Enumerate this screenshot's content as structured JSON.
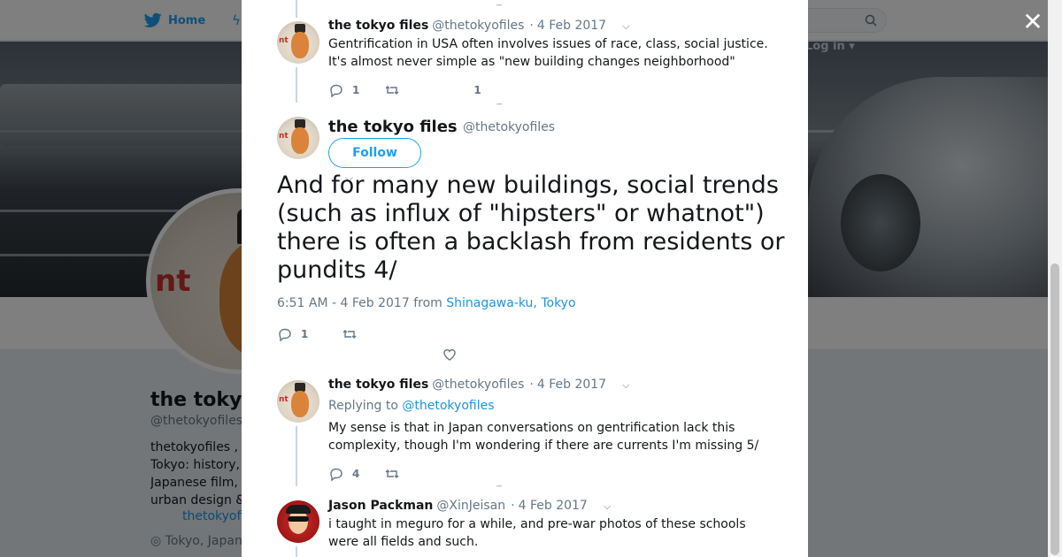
{
  "nav": {
    "home_label": "Home",
    "search_placeholder": "",
    "login_label": "Log in ▾"
  },
  "profile": {
    "name": "the tokyo files",
    "handle": "@thetokyofiles",
    "bio_lines": [
      "thetokyofiles ,",
      "Tokyo: history,",
      "Japanese film,",
      "urban design &"
    ],
    "url": "thetokyofiles",
    "location": "◎ Tokyo, Japan"
  },
  "modal": {
    "close_label": "✕",
    "tweets": [
      {
        "name": "the tokyo files",
        "handle": "@thetokyofiles",
        "date": "4 Feb 2017",
        "text": "Gentrification in USA often involves issues of race, class, social justice. It's almost never simple as \"new building changes neighborhood\"",
        "reply_count": "1",
        "like_count": "1"
      },
      {
        "name": "the tokyo files",
        "handle": "@thetokyofiles",
        "follow_label": "Follow",
        "text": "And for many new buildings, social trends (such as influx of \"hipsters\" or whatnot\") there is often a backlash from residents or pundits 4/",
        "time": "6:51 AM - 4 Feb 2017",
        "from": "from",
        "location": "Shinagawa-ku, Tokyo",
        "reply_count": "1"
      },
      {
        "name": "the tokyo files",
        "handle": "@thetokyofiles",
        "date": "4 Feb 2017",
        "replying_prefix": "Replying to",
        "replying_to": "@thetokyofiles",
        "text": "My sense is that in Japan conversations on gentrification lack this complexity, though I'm wondering if there are currents I'm missing 5/",
        "reply_count": "4"
      },
      {
        "name": "Jason Packman",
        "handle": "@XinJeisan",
        "date": "4 Feb 2017",
        "text": "i taught in meguro for a while, and pre-war photos of these schools were all fields and such."
      }
    ]
  },
  "colors": {
    "accent": "#1da1f2",
    "link": "#1b95e0",
    "muted": "#657786",
    "text": "#14171a"
  }
}
